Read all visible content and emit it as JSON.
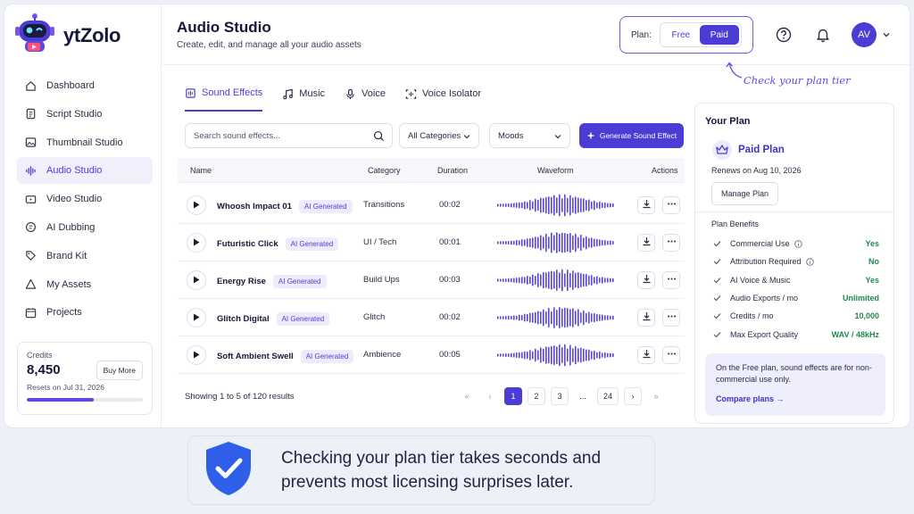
{
  "app": {
    "name": "ytZolo"
  },
  "sidebar": {
    "items": [
      {
        "label": "Dashboard",
        "icon": "home-icon"
      },
      {
        "label": "Script Studio",
        "icon": "document-icon"
      },
      {
        "label": "Thumbnail Studio",
        "icon": "image-icon"
      },
      {
        "label": "Audio Studio",
        "icon": "audio-waveform-icon",
        "active": true
      },
      {
        "label": "Video Studio",
        "icon": "video-icon"
      },
      {
        "label": "AI Dubbing",
        "icon": "dubbing-icon"
      },
      {
        "label": "Brand Kit",
        "icon": "tag-icon"
      },
      {
        "label": "My Assets",
        "icon": "folder-icon"
      },
      {
        "label": "Projects",
        "icon": "calendar-icon"
      }
    ],
    "credits": {
      "label": "Credits",
      "value": "8,450",
      "buy_label": "Buy More",
      "reset": "Resets on Jul 31, 2026",
      "usage_fraction": 0.58
    }
  },
  "header": {
    "title": "Audio Studio",
    "subtitle": "Create, edit, and manage all your audio assets",
    "plan_label": "Plan:",
    "plan_options": [
      "Free",
      "Paid"
    ],
    "plan_selected": "Paid",
    "avatar": "AV",
    "callout": "Check your plan tier"
  },
  "tabs": [
    {
      "label": "Sound Effects",
      "active": true
    },
    {
      "label": "Music"
    },
    {
      "label": "Voice"
    },
    {
      "label": "Voice Isolator"
    }
  ],
  "toolbar": {
    "search_placeholder": "Search sound effects...",
    "category": "All Categories",
    "moods": "Moods",
    "generate_label": "Generate Sound Effect"
  },
  "table": {
    "columns": [
      "Name",
      "Category",
      "Duration",
      "Waveform",
      "Actions"
    ],
    "rows": [
      {
        "name": "Whoosh Impact 01",
        "badge": "AI Generated",
        "category": "Transitions",
        "duration": "00:02"
      },
      {
        "name": "Futuristic Click",
        "badge": "AI Generated",
        "category": "UI / Tech",
        "duration": "00:01"
      },
      {
        "name": "Energy Rise",
        "badge": "AI Generated",
        "category": "Build Ups",
        "duration": "00:03"
      },
      {
        "name": "Glitch Digital",
        "badge": "AI Generated",
        "category": "Glitch",
        "duration": "00:02"
      },
      {
        "name": "Soft Ambient Swell",
        "badge": "AI Generated",
        "category": "Ambience",
        "duration": "00:05"
      }
    ],
    "results": "Showing 1 to 5 of 120 results",
    "pages": [
      "1",
      "2",
      "3",
      "...",
      "24"
    ],
    "current_page": "1"
  },
  "plan_panel": {
    "title": "Your Plan",
    "plan_name": "Paid Plan",
    "renews": "Renews on Aug 10, 2026",
    "manage_label": "Manage Plan",
    "benefits_title": "Plan Benefits",
    "benefits": [
      {
        "label": "Commercial Use",
        "value": "Yes",
        "info": true
      },
      {
        "label": "Attribution Required",
        "value": "No",
        "info": true
      },
      {
        "label": "AI Voice & Music",
        "value": "Yes"
      },
      {
        "label": "Audio Exports / mo",
        "value": "Unlimited"
      },
      {
        "label": "Credits / mo",
        "value": "10,000"
      },
      {
        "label": "Max Export Quality",
        "value": "WAV / 48kHz"
      }
    ],
    "note": "On the Free plan, sound effects are for non-commercial use only.",
    "compare_label": "Compare plans →"
  },
  "banner": {
    "text": "Checking your plan tier takes seconds and prevents most licensing surprises later."
  },
  "colors": {
    "accent": "#4a3cd4",
    "success": "#1f8a4c",
    "badge_bg": "#eeecfc"
  }
}
